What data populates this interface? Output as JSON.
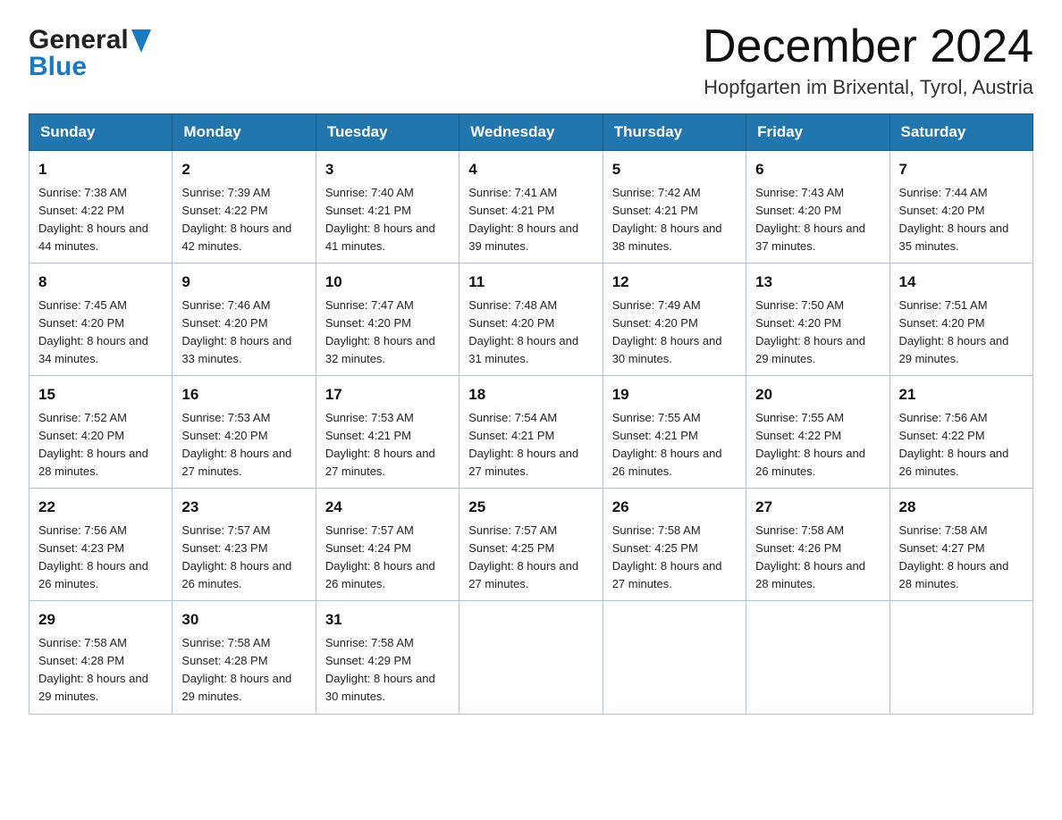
{
  "header": {
    "logo_general": "General",
    "logo_blue": "Blue",
    "month_title": "December 2024",
    "location": "Hopfgarten im Brixental, Tyrol, Austria"
  },
  "weekdays": [
    "Sunday",
    "Monday",
    "Tuesday",
    "Wednesday",
    "Thursday",
    "Friday",
    "Saturday"
  ],
  "weeks": [
    [
      {
        "day": "1",
        "sunrise": "7:38 AM",
        "sunset": "4:22 PM",
        "daylight": "8 hours and 44 minutes."
      },
      {
        "day": "2",
        "sunrise": "7:39 AM",
        "sunset": "4:22 PM",
        "daylight": "8 hours and 42 minutes."
      },
      {
        "day": "3",
        "sunrise": "7:40 AM",
        "sunset": "4:21 PM",
        "daylight": "8 hours and 41 minutes."
      },
      {
        "day": "4",
        "sunrise": "7:41 AM",
        "sunset": "4:21 PM",
        "daylight": "8 hours and 39 minutes."
      },
      {
        "day": "5",
        "sunrise": "7:42 AM",
        "sunset": "4:21 PM",
        "daylight": "8 hours and 38 minutes."
      },
      {
        "day": "6",
        "sunrise": "7:43 AM",
        "sunset": "4:20 PM",
        "daylight": "8 hours and 37 minutes."
      },
      {
        "day": "7",
        "sunrise": "7:44 AM",
        "sunset": "4:20 PM",
        "daylight": "8 hours and 35 minutes."
      }
    ],
    [
      {
        "day": "8",
        "sunrise": "7:45 AM",
        "sunset": "4:20 PM",
        "daylight": "8 hours and 34 minutes."
      },
      {
        "day": "9",
        "sunrise": "7:46 AM",
        "sunset": "4:20 PM",
        "daylight": "8 hours and 33 minutes."
      },
      {
        "day": "10",
        "sunrise": "7:47 AM",
        "sunset": "4:20 PM",
        "daylight": "8 hours and 32 minutes."
      },
      {
        "day": "11",
        "sunrise": "7:48 AM",
        "sunset": "4:20 PM",
        "daylight": "8 hours and 31 minutes."
      },
      {
        "day": "12",
        "sunrise": "7:49 AM",
        "sunset": "4:20 PM",
        "daylight": "8 hours and 30 minutes."
      },
      {
        "day": "13",
        "sunrise": "7:50 AM",
        "sunset": "4:20 PM",
        "daylight": "8 hours and 29 minutes."
      },
      {
        "day": "14",
        "sunrise": "7:51 AM",
        "sunset": "4:20 PM",
        "daylight": "8 hours and 29 minutes."
      }
    ],
    [
      {
        "day": "15",
        "sunrise": "7:52 AM",
        "sunset": "4:20 PM",
        "daylight": "8 hours and 28 minutes."
      },
      {
        "day": "16",
        "sunrise": "7:53 AM",
        "sunset": "4:20 PM",
        "daylight": "8 hours and 27 minutes."
      },
      {
        "day": "17",
        "sunrise": "7:53 AM",
        "sunset": "4:21 PM",
        "daylight": "8 hours and 27 minutes."
      },
      {
        "day": "18",
        "sunrise": "7:54 AM",
        "sunset": "4:21 PM",
        "daylight": "8 hours and 27 minutes."
      },
      {
        "day": "19",
        "sunrise": "7:55 AM",
        "sunset": "4:21 PM",
        "daylight": "8 hours and 26 minutes."
      },
      {
        "day": "20",
        "sunrise": "7:55 AM",
        "sunset": "4:22 PM",
        "daylight": "8 hours and 26 minutes."
      },
      {
        "day": "21",
        "sunrise": "7:56 AM",
        "sunset": "4:22 PM",
        "daylight": "8 hours and 26 minutes."
      }
    ],
    [
      {
        "day": "22",
        "sunrise": "7:56 AM",
        "sunset": "4:23 PM",
        "daylight": "8 hours and 26 minutes."
      },
      {
        "day": "23",
        "sunrise": "7:57 AM",
        "sunset": "4:23 PM",
        "daylight": "8 hours and 26 minutes."
      },
      {
        "day": "24",
        "sunrise": "7:57 AM",
        "sunset": "4:24 PM",
        "daylight": "8 hours and 26 minutes."
      },
      {
        "day": "25",
        "sunrise": "7:57 AM",
        "sunset": "4:25 PM",
        "daylight": "8 hours and 27 minutes."
      },
      {
        "day": "26",
        "sunrise": "7:58 AM",
        "sunset": "4:25 PM",
        "daylight": "8 hours and 27 minutes."
      },
      {
        "day": "27",
        "sunrise": "7:58 AM",
        "sunset": "4:26 PM",
        "daylight": "8 hours and 28 minutes."
      },
      {
        "day": "28",
        "sunrise": "7:58 AM",
        "sunset": "4:27 PM",
        "daylight": "8 hours and 28 minutes."
      }
    ],
    [
      {
        "day": "29",
        "sunrise": "7:58 AM",
        "sunset": "4:28 PM",
        "daylight": "8 hours and 29 minutes."
      },
      {
        "day": "30",
        "sunrise": "7:58 AM",
        "sunset": "4:28 PM",
        "daylight": "8 hours and 29 minutes."
      },
      {
        "day": "31",
        "sunrise": "7:58 AM",
        "sunset": "4:29 PM",
        "daylight": "8 hours and 30 minutes."
      },
      null,
      null,
      null,
      null
    ]
  ]
}
